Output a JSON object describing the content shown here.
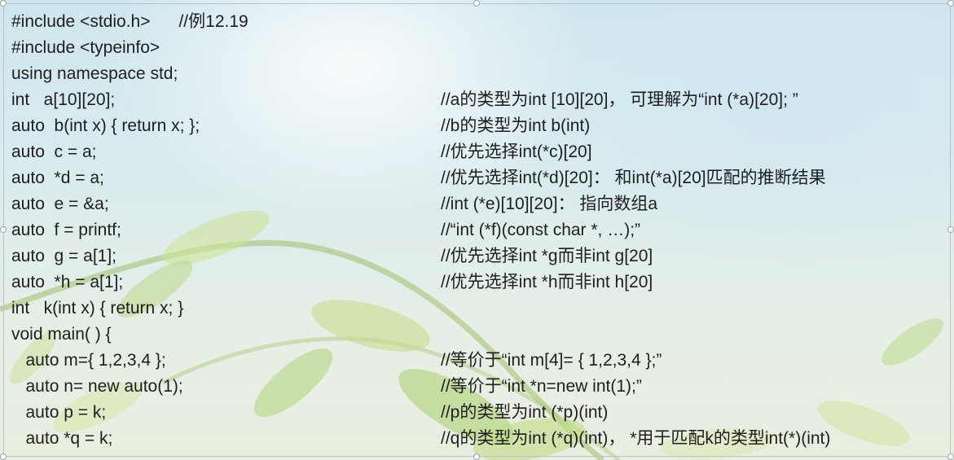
{
  "slide": {
    "lines": [
      {
        "code": "#include <stdio.h>      //例12.19",
        "comment": ""
      },
      {
        "code": "#include <typeinfo>",
        "comment": ""
      },
      {
        "code": "using namespace std;",
        "comment": ""
      },
      {
        "code": "int   a[10][20];",
        "comment": "//a的类型为int [10][20]， 可理解为“int (*a)[20]; ”"
      },
      {
        "code": "auto  b(int x) { return x; };",
        "comment": "//b的类型为int b(int)"
      },
      {
        "code": "auto  c = a;",
        "comment": "//优先选择int(*c)[20]"
      },
      {
        "code": "auto  *d = a;",
        "comment": "//优先选择int(*d)[20]： 和int(*a)[20]匹配的推断结果"
      },
      {
        "code": "auto  e = &a;",
        "comment": "//int (*e)[10][20]： 指向数组a"
      },
      {
        "code": "auto  f = printf;",
        "comment": "//“int (*f)(const char *, …);”"
      },
      {
        "code": "auto  g = a[1];",
        "comment": "//优先选择int *g而非int g[20]"
      },
      {
        "code": "auto  *h = a[1];",
        "comment": "//优先选择int *h而非int h[20]"
      },
      {
        "code": "int   k(int x) { return x; }",
        "comment": ""
      },
      {
        "code": "void main( ) {",
        "comment": ""
      },
      {
        "code": "   auto m={ 1,2,3,4 };",
        "comment": "//等价于“int m[4]= { 1,2,3,4 };”"
      },
      {
        "code": "   auto n= new auto(1);",
        "comment": "//等价于“int *n=new int(1);”"
      },
      {
        "code": "   auto p = k;",
        "comment": "//p的类型为int (*p)(int)"
      },
      {
        "code": "   auto *q = k;",
        "comment": "//q的类型为int (*q)(int)， *用于匹配k的类型int(*)(int)"
      }
    ]
  }
}
